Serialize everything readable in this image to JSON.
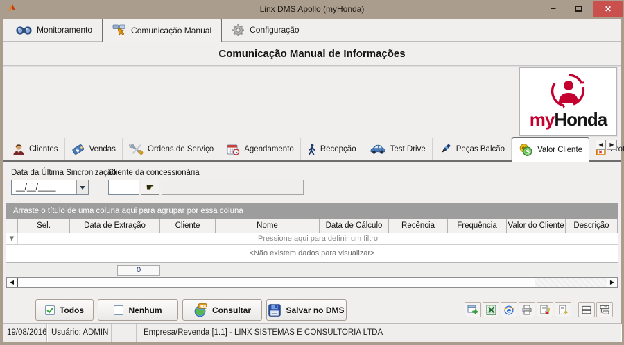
{
  "window": {
    "title": "Linx DMS Apollo (myHonda)"
  },
  "window_controls": {
    "minimize": "–",
    "close": "✕"
  },
  "main_tabs": [
    {
      "label": "Monitoramento",
      "selected": false
    },
    {
      "label": "Comunicação Manual",
      "selected": true
    },
    {
      "label": "Configuração",
      "selected": false
    }
  ],
  "heading": "Comunicação Manual de Informações",
  "logo": {
    "my": "my",
    "honda": "Honda"
  },
  "module_tabs": [
    {
      "label": "Clientes",
      "icon": "client-person-icon",
      "selected": false
    },
    {
      "label": "Vendas",
      "icon": "price-tag-icon",
      "selected": false
    },
    {
      "label": "Ordens de Serviço",
      "icon": "tools-icon",
      "selected": false
    },
    {
      "label": "Agendamento",
      "icon": "calendar-clock-icon",
      "selected": false
    },
    {
      "label": "Recepção",
      "icon": "walking-person-icon",
      "selected": false
    },
    {
      "label": "Test Drive",
      "icon": "car-icon",
      "selected": false
    },
    {
      "label": "Peças Balcão",
      "icon": "pen-tool-icon",
      "selected": false
    },
    {
      "label": "Valor Cliente",
      "icon": "coins-icon",
      "selected": true
    },
    {
      "label": "Protocolo de Envio",
      "icon": "clipboard-check-icon",
      "selected": false
    },
    {
      "label": "",
      "icon": "org-chart-icon",
      "selected": false
    }
  ],
  "tab_scroll": {
    "left": "◀",
    "right": "▶"
  },
  "filters": {
    "sync_label": "Data da Última Sincronização",
    "sync_value": "__/__/____",
    "client_label": "Cliente da concessionária",
    "client_code_value": "",
    "client_name_value": ""
  },
  "grid": {
    "group_hint": "Arraste o título de uma coluna aqui para agrupar por essa coluna",
    "columns": [
      "Sel.",
      "Data de Extração",
      "Cliente",
      "Nome",
      "Data de Cálculo",
      "Recência",
      "Frequência",
      "Valor do Cliente",
      "Descrição"
    ],
    "filter_hint": "Pressione aqui para definir um filtro",
    "empty_message": "<Não existem dados para visualizar>",
    "count": "0"
  },
  "buttons": {
    "todos": "Todos",
    "nenhum": "Nenhum",
    "consultar": "Consultar",
    "salvar": "Salvar no DMS"
  },
  "toolbar_icons": [
    "export-grid-icon",
    "excel-icon",
    "browser-icon",
    "print-icon",
    "print-export-icon",
    "report-sparkle-icon",
    "rows-icon",
    "rows-pointer-icon"
  ],
  "scrollbar": {
    "left": "◀",
    "right": "▶"
  },
  "status": {
    "date": "19/08/2016",
    "user": "Usuário: ADMIN",
    "company": "Empresa/Revenda [1.1] - LINX SISTEMAS E CONSULTORIA LTDA"
  }
}
